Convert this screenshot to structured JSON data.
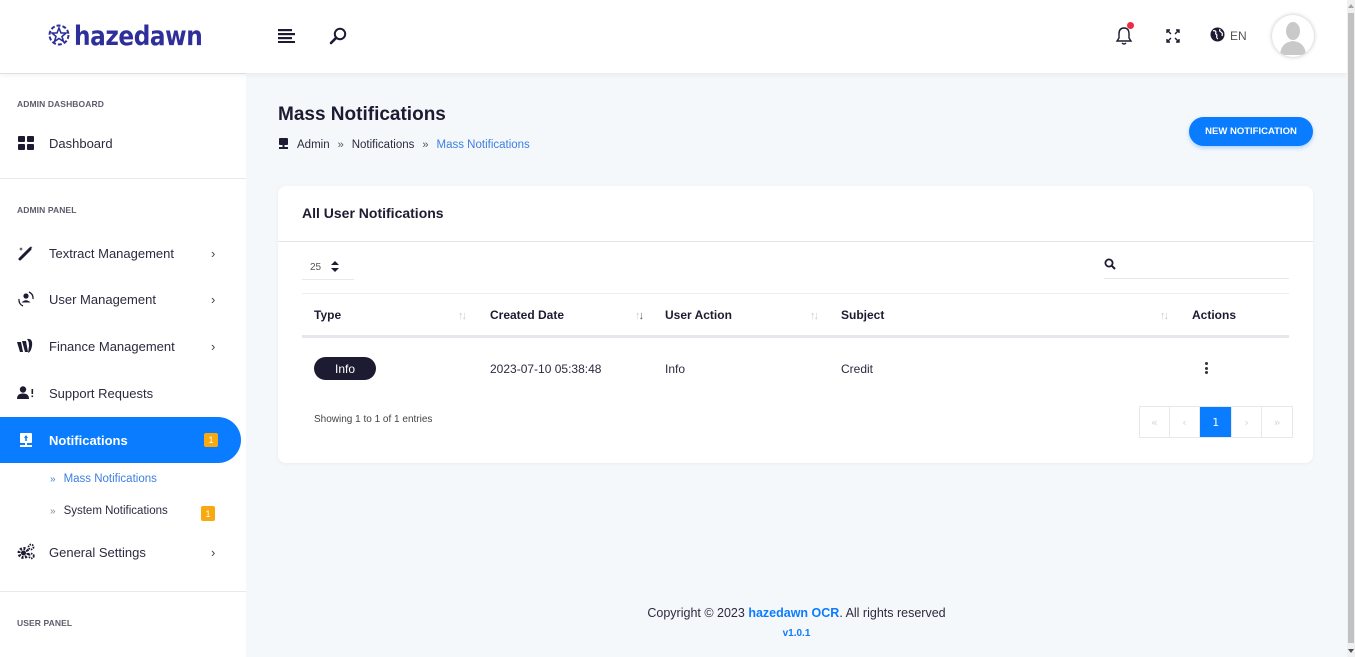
{
  "app": {
    "brand": "hazedawn",
    "language": "EN",
    "notification_dot_color": "#ef2b44",
    "accent_color": "#0a7cff"
  },
  "sidebar": {
    "sections": [
      {
        "label": "ADMIN DASHBOARD"
      },
      {
        "label": "ADMIN PANEL"
      },
      {
        "label": "USER PANEL"
      }
    ],
    "items": [
      {
        "label": "Dashboard",
        "icon": "grid-icon"
      },
      {
        "label": "Textract Management",
        "icon": "magic-wand-icon",
        "chevron": "›"
      },
      {
        "label": "User Management",
        "icon": "user-sync-icon",
        "chevron": "›"
      },
      {
        "label": "Finance Management",
        "icon": "finance-icon",
        "chevron": "›"
      },
      {
        "label": "Support Requests",
        "icon": "user-alert-icon"
      },
      {
        "label": "Notifications",
        "icon": "monitor-upload-icon",
        "badge": "1"
      },
      {
        "label": "General Settings",
        "icon": "gears-icon",
        "chevron": "›"
      }
    ],
    "sub_items": [
      {
        "label": "Mass Notifications",
        "arrow": "»"
      },
      {
        "label": "System Notifications",
        "arrow": "»",
        "badge": "1"
      }
    ]
  },
  "page": {
    "title": "Mass Notifications",
    "breadcrumb": [
      "Admin",
      "Notifications",
      "Mass Notifications"
    ],
    "breadcrumb_sep": "»",
    "new_button": "NEW NOTIFICATION"
  },
  "card": {
    "title": "All User Notifications",
    "page_length": "25",
    "search_value": "",
    "columns": [
      "Type",
      "Created Date",
      "User Action",
      "Subject",
      "Actions"
    ],
    "rows": [
      {
        "type": "Info",
        "created_date": "2023-07-10 05:38:48",
        "user_action": "Info",
        "subject": "Credit"
      }
    ],
    "info": "Showing 1 to 1 of 1 entries",
    "pagination": {
      "first": "«",
      "prev": "‹",
      "current": "1",
      "next": "›",
      "last": "»"
    }
  },
  "footer": {
    "prefix": "Copyright © 2023 ",
    "brand": "hazedawn OCR",
    "suffix": ". All rights reserved",
    "version": "v1.0.1"
  }
}
